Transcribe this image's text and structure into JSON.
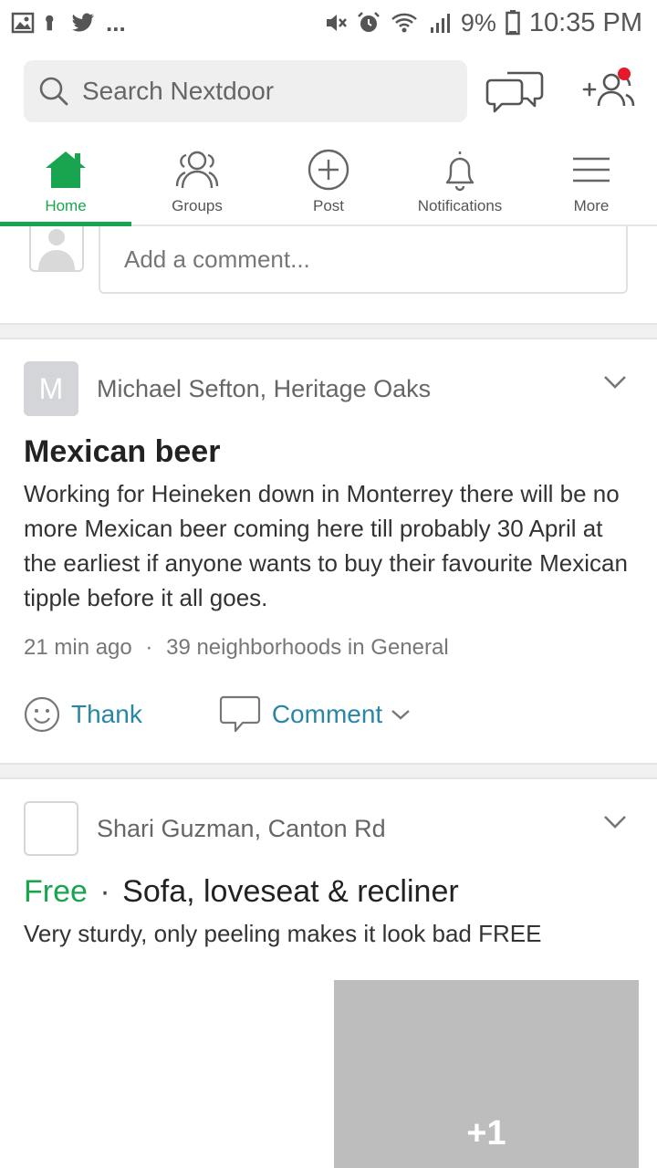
{
  "status_bar": {
    "left_icons": [
      "image-icon",
      "keyhole-icon",
      "twitter-icon"
    ],
    "more": "...",
    "right_icons": [
      "mute-icon",
      "alarm-icon",
      "wifi-icon",
      "signal-icon"
    ],
    "battery": "9%",
    "time": "10:35 PM"
  },
  "search": {
    "placeholder": "Search Nextdoor"
  },
  "header_icons": {
    "chat": "chat-bubbles-icon",
    "invite": "add-neighbor-icon",
    "invite_badge_color": "#e5192b"
  },
  "nav": {
    "items": [
      {
        "label": "Home",
        "icon": "home-icon",
        "active": true
      },
      {
        "label": "Groups",
        "icon": "groups-icon",
        "active": false
      },
      {
        "label": "Post",
        "icon": "plus-circle-icon",
        "active": false
      },
      {
        "label": "Notifications",
        "icon": "bell-icon",
        "active": false
      },
      {
        "label": "More",
        "icon": "menu-icon",
        "active": false
      }
    ],
    "active_color": "#19a54f"
  },
  "composer": {
    "placeholder": "Add a comment..."
  },
  "posts": [
    {
      "avatar_letter": "M",
      "author": "Michael Sefton, Heritage Oaks",
      "title": "Mexican beer",
      "body": "Working for Heineken down in Monterrey there will be no more Mexican beer coming here till probably 30 April at the earliest if anyone wants to buy their favourite Mexican tipple before it all goes.",
      "meta_time": "21 min ago",
      "meta_sep": "·",
      "meta_scope": "39 neighborhoods in General",
      "thank_label": "Thank",
      "comment_label": "Comment"
    },
    {
      "avatar_letter": "",
      "author": "Shari Guzman, Canton Rd",
      "tag": "Free",
      "tag_sep": "·",
      "title": "Sofa, loveseat & recliner",
      "body": "Very sturdy, only peeling makes it look bad FREE",
      "photo_count": "+1"
    }
  ],
  "colors": {
    "link": "#2a86a8",
    "green": "#19a54f"
  }
}
